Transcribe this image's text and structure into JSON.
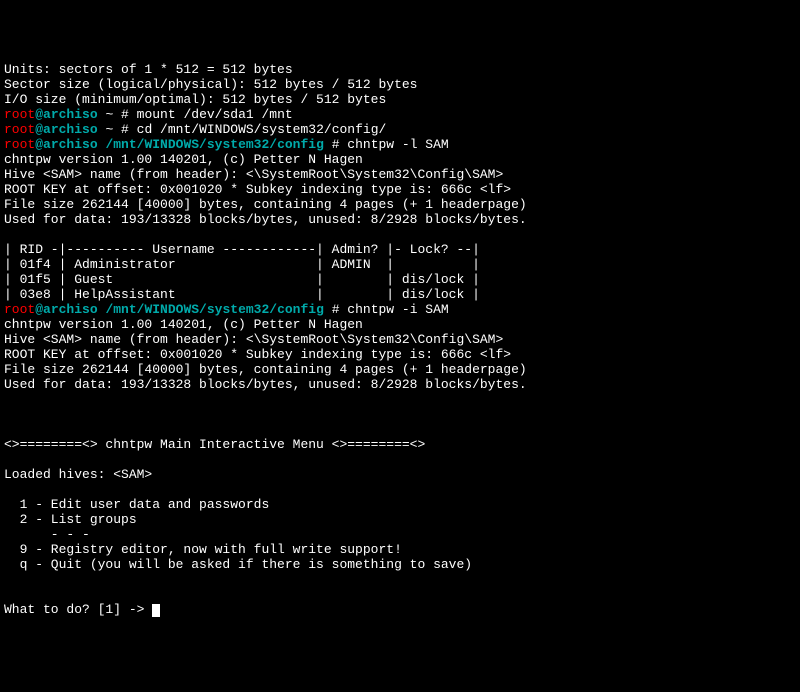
{
  "disk_info": {
    "units": "Units: sectors of 1 * 512 = 512 bytes",
    "sector_size": "Sector size (logical/physical): 512 bytes / 512 bytes",
    "io_size": "I/O size (minimum/optimal): 512 bytes / 512 bytes"
  },
  "prompts": {
    "user": "root",
    "at_host": "@archiso",
    "cwd1": " ~ ",
    "cwd2": " /mnt/WINDOWS/system32/config ",
    "sep": "# "
  },
  "commands": {
    "mount": "mount /dev/sda1 /mnt",
    "cd": "cd /mnt/WINDOWS/system32/config/",
    "chntpw_l": "chntpw -l SAM",
    "chntpw_i": "chntpw -i SAM"
  },
  "chntpw": {
    "version": "chntpw version 1.00 140201, (c) Petter N Hagen",
    "hive": "Hive <SAM> name (from header): <\\SystemRoot\\System32\\Config\\SAM>",
    "rootkey": "ROOT KEY at offset: 0x001020 * Subkey indexing type is: 666c <lf>",
    "filesize": "File size 262144 [40000] bytes, containing 4 pages (+ 1 headerpage)",
    "usedfor": "Used for data: 193/13328 blocks/bytes, unused: 8/2928 blocks/bytes."
  },
  "user_table": {
    "header": "| RID -|---------- Username ------------| Admin? |- Lock? --|",
    "rows": [
      "| 01f4 | Administrator                  | ADMIN  |          |",
      "| 01f5 | Guest                          |        | dis/lock |",
      "| 03e8 | HelpAssistant                  |        | dis/lock |"
    ]
  },
  "menu": {
    "blank": "",
    "divider": "<>========<> chntpw Main Interactive Menu <>========<>",
    "loaded": "Loaded hives: <SAM>",
    "opt1": "  1 - Edit user data and passwords",
    "opt2": "  2 - List groups",
    "dashes": "      - - -",
    "opt9": "  9 - Registry editor, now with full write support!",
    "optq": "  q - Quit (you will be asked if there is something to save)",
    "prompt": "What to do? [1] -> "
  }
}
